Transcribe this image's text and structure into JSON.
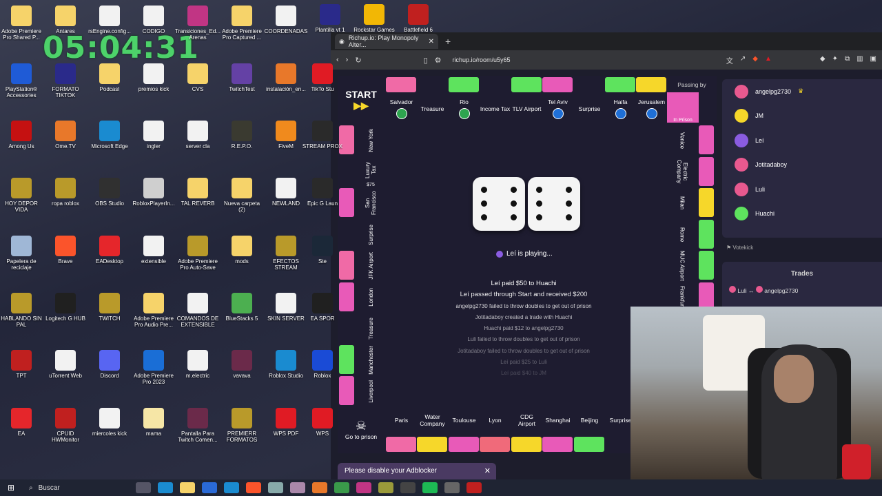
{
  "clock": "05:04:31",
  "desktop_icons": [
    {
      "label": "Adobe Premiere Pro Shared P...",
      "color": "#f6d36a"
    },
    {
      "label": "Antares",
      "color": "#f6d36a"
    },
    {
      "label": "rsEngine.config...",
      "color": "#f2f2f2"
    },
    {
      "label": "CODIGO",
      "color": "#f2f2f2"
    },
    {
      "label": "Transiciones_Ed... Arenas",
      "color": "#c13584"
    },
    {
      "label": "Adobe Premiere Pro Captured ...",
      "color": "#f6d36a"
    },
    {
      "label": "COORDENADAS",
      "color": "#f2f2f2"
    },
    {
      "label": "Plantilla vt 1",
      "color": "#2a2a8a"
    },
    {
      "label": "Rockstar Games",
      "color": "#f2b705"
    },
    {
      "label": "Battlefield 6",
      "color": "#c0201f"
    },
    {
      "label": "PlayStation® Accessories",
      "color": "#1f5bd6"
    },
    {
      "label": "FORMATO TIKTOK",
      "color": "#2a2a8a"
    },
    {
      "label": "Podcast",
      "color": "#f6d36a"
    },
    {
      "label": "premios kick",
      "color": "#f2f2f2"
    },
    {
      "label": "CVS",
      "color": "#f6d36a"
    },
    {
      "label": "TwitchTest",
      "color": "#6441a5"
    },
    {
      "label": "instalación_en...",
      "color": "#e8782a"
    },
    {
      "label": "TikTo Stu",
      "color": "#e01b24"
    },
    {
      "label": "Among Us",
      "color": "#c51111"
    },
    {
      "label": "Ome.TV",
      "color": "#e8782a"
    },
    {
      "label": "Microsoft Edge",
      "color": "#1a8bd0"
    },
    {
      "label": "ingler",
      "color": "#f2f2f2"
    },
    {
      "label": "server cla",
      "color": "#f2f2f2"
    },
    {
      "label": "R.E.P.O.",
      "color": "#3a3a30"
    },
    {
      "label": "FiveM",
      "color": "#f08a1d"
    },
    {
      "label": "STREAM PROX",
      "color": "#2a2a2a"
    },
    {
      "label": "HOY DEPOR VIDA",
      "color": "#b99a2a"
    },
    {
      "label": "ropa roblox",
      "color": "#b99a2a"
    },
    {
      "label": "OBS Studio",
      "color": "#303030"
    },
    {
      "label": "RobloxPlayerIn...",
      "color": "#cfcfcf"
    },
    {
      "label": "TAL REVERB",
      "color": "#f6d36a"
    },
    {
      "label": "Nueva carpeta (2)",
      "color": "#f6d36a"
    },
    {
      "label": "NEWLAND",
      "color": "#f2f2f2"
    },
    {
      "label": "Epic G Laun",
      "color": "#2a2a2a"
    },
    {
      "label": "Papelera de reciclaje",
      "color": "#9fb7d6"
    },
    {
      "label": "Brave",
      "color": "#fb542b"
    },
    {
      "label": "EADesktop",
      "color": "#e5262b"
    },
    {
      "label": "extensible",
      "color": "#f2f2f2"
    },
    {
      "label": "Adobe Premiere Pro Auto-Save",
      "color": "#b99a2a"
    },
    {
      "label": "mods",
      "color": "#f6d36a"
    },
    {
      "label": "EFECTOS STREAM",
      "color": "#b99a2a"
    },
    {
      "label": "Ste",
      "color": "#1b2838"
    },
    {
      "label": "HABLANDO SIN PAL",
      "color": "#b99a2a"
    },
    {
      "label": "Logitech G HUB",
      "color": "#202020"
    },
    {
      "label": "TWITCH",
      "color": "#b99a2a"
    },
    {
      "label": "Adobe Premiere Pro Audio Pre...",
      "color": "#f6d36a"
    },
    {
      "label": "COMANDOS DE EXTENSIBLE",
      "color": "#f2f2f2"
    },
    {
      "label": "BlueStacks 5",
      "color": "#4caf50"
    },
    {
      "label": "SKIN SERVER",
      "color": "#f2f2f2"
    },
    {
      "label": "EA SPOR",
      "color": "#202020"
    },
    {
      "label": "TPT",
      "color": "#c0201f"
    },
    {
      "label": "uTorrent Web",
      "color": "#f2f2f2"
    },
    {
      "label": "Discord",
      "color": "#5865f2"
    },
    {
      "label": "Adobe Premiere Pro 2023",
      "color": "#1a6ed6"
    },
    {
      "label": "m.electric",
      "color": "#f2f2f2"
    },
    {
      "label": "vavava",
      "color": "#6b2a4a"
    },
    {
      "label": "Roblox Studio",
      "color": "#1a8bd0"
    },
    {
      "label": "Roblox",
      "color": "#1a4bd6"
    },
    {
      "label": "EA",
      "color": "#e5262b"
    },
    {
      "label": "CPUID HWMonitor",
      "color": "#c0201f"
    },
    {
      "label": "miercoles kick",
      "color": "#f2f2f2"
    },
    {
      "label": "mama",
      "color": "#f6e6a6"
    },
    {
      "label": "Pantalla Para Twitch Comen...",
      "color": "#6b2a4a"
    },
    {
      "label": "PREMIERR FORMATOS",
      "color": "#b99a2a"
    },
    {
      "label": "WPS PDF",
      "color": "#e01b24"
    },
    {
      "label": "WPS",
      "color": "#e01b24"
    }
  ],
  "browser": {
    "tab_title": "Richup.io: Play Monopoly Alter...",
    "url": "richup.io/room/u5y65"
  },
  "board": {
    "start": "START",
    "top": [
      {
        "name": "Salvador",
        "strip": "#f06aa6",
        "flag": "#2ea44f"
      },
      {
        "name": "Treasure",
        "strip": "",
        "flag": ""
      },
      {
        "name": "Rio",
        "strip": "#5ee35e",
        "flag": "#2ea44f"
      },
      {
        "name": "Income Tax",
        "strip": "",
        "flag": ""
      },
      {
        "name": "TLV Airport",
        "strip": "#5ee35e",
        "flag": ""
      },
      {
        "name": "Tel Aviv",
        "strip": "#e85ab8",
        "flag": "#1f6fd6"
      },
      {
        "name": "Surprise",
        "strip": "",
        "flag": ""
      },
      {
        "name": "Haifa",
        "strip": "#5ee35e",
        "flag": "#1f6fd6"
      },
      {
        "name": "Jerusalem",
        "strip": "#f6d72a",
        "flag": "#1f6fd6"
      }
    ],
    "passing_by": "Passing by",
    "in_prison": "In Prison",
    "left": [
      {
        "name": "New York",
        "strip": "#f06aa6"
      },
      {
        "name": "Luxury Tax",
        "strip": ""
      },
      {
        "name": "San Francisco",
        "strip": "#e85ab8"
      },
      {
        "name": "Surprise",
        "strip": ""
      },
      {
        "name": "JFK Airport",
        "strip": "#f06aa6"
      },
      {
        "name": "London",
        "strip": "#e85ab8"
      },
      {
        "name": "Treasure",
        "strip": ""
      },
      {
        "name": "Manchester",
        "strip": "#5ee35e"
      },
      {
        "name": "Liverpool",
        "strip": "#e85ab8"
      }
    ],
    "luxury_tax_price": "$75",
    "right": [
      {
        "name": "Venice",
        "strip": "#e85ab8"
      },
      {
        "name": "Electric Company",
        "strip": "#e85ab8"
      },
      {
        "name": "Milan",
        "strip": "#f6d72a"
      },
      {
        "name": "Rome",
        "strip": "#5ee35e"
      },
      {
        "name": "MUC Airport",
        "strip": "#5ee35e"
      },
      {
        "name": "Frankfurt",
        "strip": "#e85ab8"
      }
    ],
    "bottom": [
      {
        "name": "Paris",
        "strip": "#f06aa6"
      },
      {
        "name": "Water Company",
        "strip": "#f6d72a"
      },
      {
        "name": "Toulouse",
        "strip": "#e85ab8"
      },
      {
        "name": "Lyon",
        "strip": "#f06a7a"
      },
      {
        "name": "CDG Airport",
        "strip": "#f6d72a"
      },
      {
        "name": "Shanghai",
        "strip": "#e85ab8"
      },
      {
        "name": "Beijing",
        "strip": "#5ee35e"
      },
      {
        "name": "Surprise",
        "strip": ""
      }
    ],
    "go_to_prison": "Go to prison",
    "status": "Leí is playing...",
    "log": [
      "Leí paid $50 to Huachi",
      "Leí passed through Start and received $200",
      "angelpg2730 failed to throw doubles to get out of prison",
      "Jotitadaboy created a trade with Huachi",
      "Huachi paid $12 to angelpg2730",
      "Luli failed to throw doubles to get out of prison",
      "Jotitadaboy failed to throw doubles to get out of prison",
      "Leí paid $25 to Luli",
      "Leí paid $40 to JM"
    ]
  },
  "players": [
    {
      "name": "angelpg2730",
      "color": "#e8598f",
      "crown": "♛"
    },
    {
      "name": "JM",
      "color": "#f6d72a",
      "crown": ""
    },
    {
      "name": "Leí",
      "color": "#8a5ce0",
      "crown": ""
    },
    {
      "name": "Jotitadaboy",
      "color": "#e8598f",
      "crown": ""
    },
    {
      "name": "Luli",
      "color": "#e8598f",
      "crown": ""
    },
    {
      "name": "Huachi",
      "color": "#5ee35e",
      "crown": ""
    }
  ],
  "votekick": "Votekick",
  "trades": {
    "title": "Trades",
    "row": {
      "from": "Luli",
      "arrow": "↔",
      "to": "angelpg2730"
    }
  },
  "adblock": "Please disable your Adblocker",
  "taskbar": {
    "search": "Buscar"
  }
}
